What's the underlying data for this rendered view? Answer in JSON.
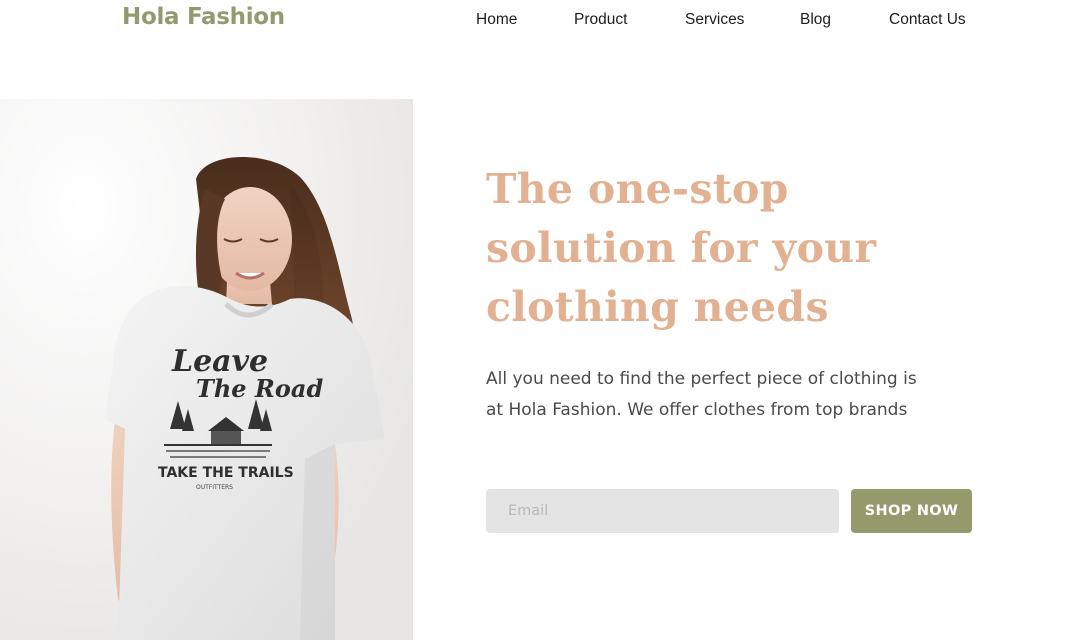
{
  "brand": {
    "name": "Hola Fashion",
    "color": "#949a70"
  },
  "nav": {
    "items": [
      {
        "label": "Home"
      },
      {
        "label": "Product"
      },
      {
        "label": "Services"
      },
      {
        "label": "Blog"
      },
      {
        "label": "Contact Us"
      }
    ]
  },
  "hero": {
    "headline": "The one-stop solution for your clothing needs",
    "headline_color": "#e2b192",
    "subtext": "All you need to find the perfect piece of clothing is at Hola Fashion. We offer clothes from top brands",
    "image": {
      "subject": "woman-in-white-tshirt",
      "shirt_print_lines": [
        "Leave",
        "The Road",
        "TAKE THE TRAILS",
        "OUTFITTERS"
      ]
    }
  },
  "signup": {
    "email_placeholder": "Email",
    "email_value": "",
    "button_label": "SHOP NOW",
    "button_color": "#959a6d"
  }
}
